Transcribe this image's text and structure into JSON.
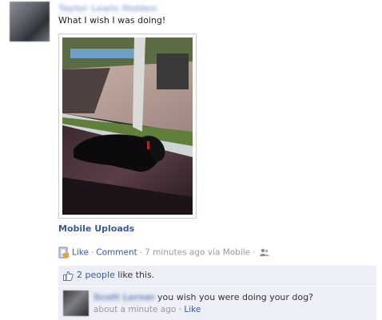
{
  "post": {
    "author_name": "Taylor Lewis Holden",
    "status_text": "What I wish I was doing!",
    "album_link": "Mobile Uploads",
    "actions": {
      "like_label": "Like",
      "comment_label": "Comment",
      "separator": "·",
      "timestamp": "7 minutes ago via Mobile",
      "mobile_icon": "mobile-upload-icon",
      "audience_icon": "friends-icon"
    },
    "likes": {
      "icon": "thumbs-up-icon",
      "people_link": "2 people",
      "suffix": "like this."
    },
    "comment": {
      "author_name": "Scott Lerner",
      "text": "you wish you were doing your dog?",
      "timestamp": "about a minute ago",
      "like_label": "Like",
      "separator": "·"
    }
  },
  "colors": {
    "link": "#3b5998",
    "ufi_background": "#eceff5",
    "meta_text": "#999999"
  }
}
